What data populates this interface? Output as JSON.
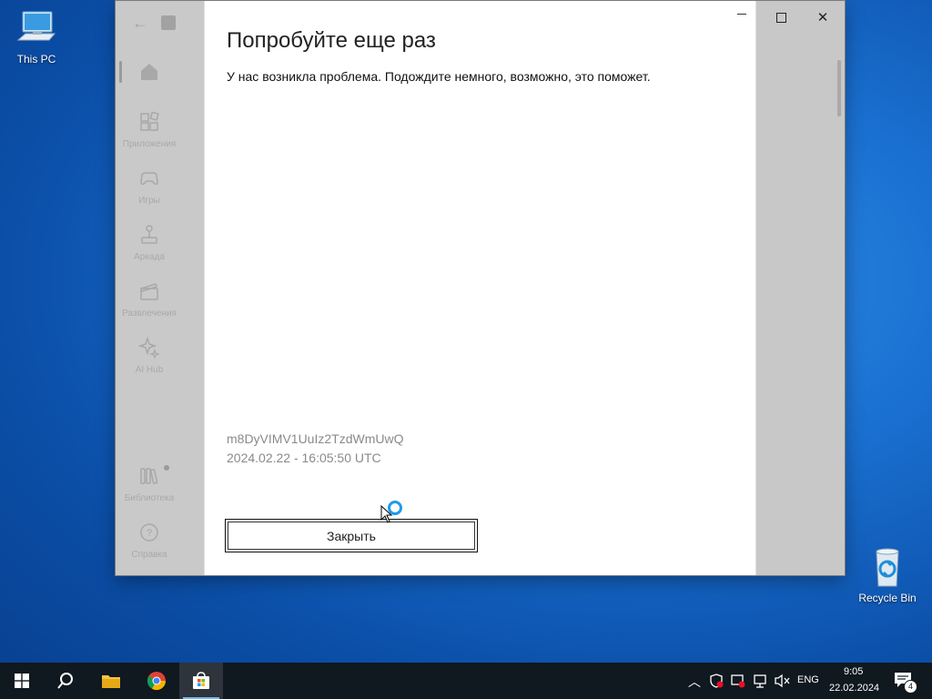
{
  "desktop": {
    "icons": [
      {
        "label": "This PC"
      },
      {
        "label": "Recycle Bin"
      }
    ]
  },
  "store_window": {
    "sidebar": {
      "items": [
        {
          "label": "Приложения",
          "icon": "apps-icon"
        },
        {
          "label": "Игры",
          "icon": "gamepad-icon"
        },
        {
          "label": "Аркада",
          "icon": "joystick-icon"
        },
        {
          "label": "Развлечения",
          "icon": "clapperboard-icon"
        },
        {
          "label": "AI Hub",
          "icon": "sparkle-icon"
        },
        {
          "label": "Библиотека",
          "icon": "library-icon"
        },
        {
          "label": "Справка",
          "icon": "help-icon"
        }
      ]
    },
    "dialog": {
      "title": "Попробуйте еще раз",
      "message": "У нас возникла проблема. Подождите немного, возможно, это поможет.",
      "error_code": "m8DyVIMV1UuIz2TzdWmUwQ",
      "timestamp": "2024.02.22 - 16:05:50 UTC",
      "close_button": "Закрыть"
    }
  },
  "taskbar": {
    "language": "ENG",
    "time": "9:05",
    "date": "22.02.2024",
    "notification_count": "4"
  },
  "colors": {
    "accent": "#1e9be8",
    "taskbar": "#101820",
    "desktop": "#1a6fd0"
  }
}
